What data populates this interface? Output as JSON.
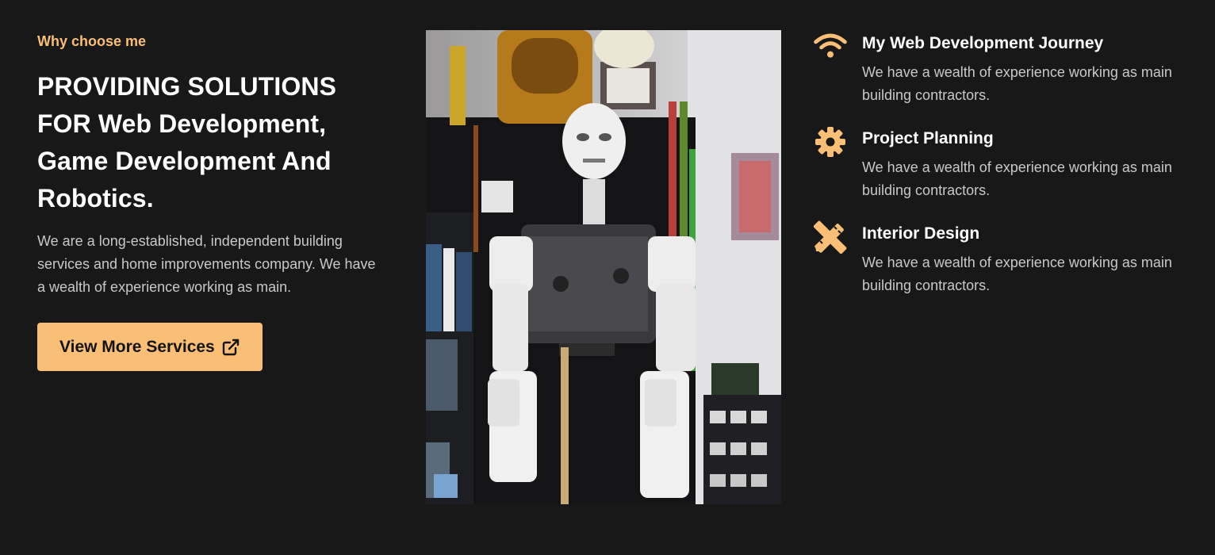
{
  "colors": {
    "accent": "#f9bf76",
    "background": "#181818",
    "heading": "#ffffff",
    "body_text": "#c9c9c9"
  },
  "left": {
    "eyebrow": "Why choose me",
    "headline": "PROVIDING SOLUTIONS FOR Web Development, Game Development And Robotics.",
    "intro": "We are a long-established, independent building services and home improvements company. We have a wealth of experience working as main.",
    "cta_label": "View More Services",
    "cta_icon": "external-link-icon"
  },
  "photo": {
    "subject": "photo-3d-printed-humanoid-robot"
  },
  "features": [
    {
      "icon": "wifi-icon",
      "title": "My Web Development Journey",
      "description": "We have a wealth of experience working as main building contractors."
    },
    {
      "icon": "gear-icon",
      "title": "Project Planning",
      "description": "We have a wealth of experience working as main building contractors."
    },
    {
      "icon": "pencil-ruler-icon",
      "title": "Interior Design",
      "description": "We have a wealth of experience working as main building contractors."
    }
  ]
}
